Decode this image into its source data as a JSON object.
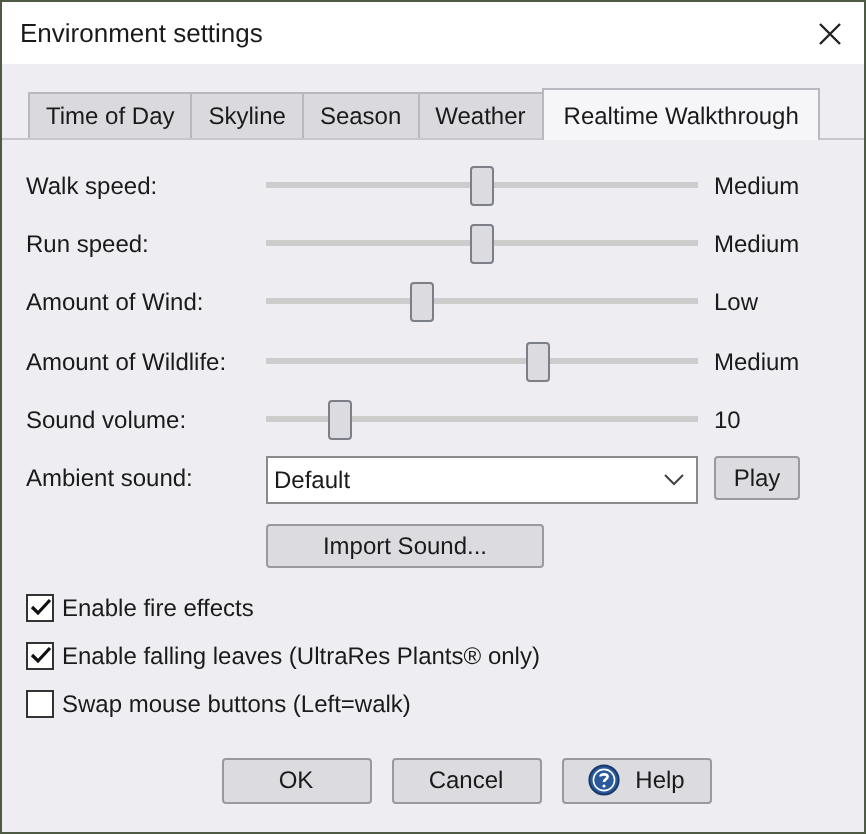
{
  "window": {
    "title": "Environment settings"
  },
  "tabs": [
    {
      "label": "Time of Day",
      "selected": false
    },
    {
      "label": "Skyline",
      "selected": false
    },
    {
      "label": "Season",
      "selected": false
    },
    {
      "label": "Weather",
      "selected": false
    },
    {
      "label": "Realtime Walkthrough",
      "selected": true
    }
  ],
  "sliders": [
    {
      "label": "Walk speed:",
      "level": 0.5,
      "reading": "Medium"
    },
    {
      "label": "Run speed:",
      "level": 0.5,
      "reading": "Medium"
    },
    {
      "label": "Amount of Wind:",
      "level": 0.36,
      "reading": "Low"
    },
    {
      "label": "Amount of Wildlife:",
      "level": 0.63,
      "reading": "Medium"
    },
    {
      "label": "Sound volume:",
      "level": 0.17,
      "reading": "10"
    }
  ],
  "ambient_sound": {
    "label": "Ambient sound:",
    "value": "Default",
    "play_button": "Play"
  },
  "import_button": "Import Sound...",
  "checkboxes": [
    {
      "label": "Enable fire effects",
      "checked": true
    },
    {
      "label": "Enable falling leaves (UltraRes Plants® only)",
      "checked": true
    },
    {
      "label": "Swap mouse buttons (Left=walk)",
      "checked": false
    }
  ],
  "buttons": [
    {
      "label": "OK",
      "kind": "plain"
    },
    {
      "label": "Cancel",
      "kind": "plain"
    },
    {
      "label": "Help",
      "kind": "help"
    }
  ]
}
